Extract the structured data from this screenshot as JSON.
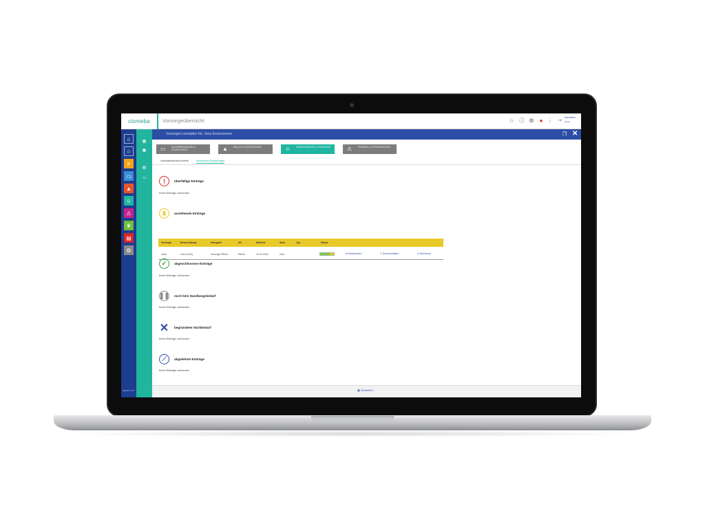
{
  "app": {
    "logo": "clomeba",
    "page_title": "Vorsorgeübersicht",
    "user": {
      "name": "Abmelden",
      "role": "admin"
    },
    "version": "Version 4.0.1"
  },
  "header": {
    "title": "Vorsorgen verwalten für: Jens Environment"
  },
  "categories": [
    {
      "label": "UNTERWEISUNGEN & SCHULUNGEN",
      "icon": "laptop-icon",
      "active": false
    },
    {
      "label": "SKILLS & KOMPETENZEN",
      "icon": "graduation-icon",
      "active": false
    },
    {
      "label": "ARBEITSMEDIZIN & VORSORGE",
      "icon": "doctor-icon",
      "active": true
    },
    {
      "label": "PRÄMIEN & GEFÄHRDUNGEN",
      "icon": "warning-icon",
      "active": false
    }
  ],
  "subtabs": [
    {
      "label": "Vorsorgeübersicht erstellt",
      "active": false
    },
    {
      "label": "Anstehende Bewertungen",
      "active": true
    }
  ],
  "sections": {
    "overdue": {
      "title": "überfällige Einträge",
      "empty": "Keine Einträge vorhanden.",
      "color": "#d9262a"
    },
    "upcoming": {
      "title": "anstehende Einträge",
      "color": "#e8c92a"
    },
    "completed": {
      "title": "abgeschlossene Einträge",
      "empty": "Keine Einträge vorhanden.",
      "color": "#2aa33a"
    },
    "no_action": {
      "title": "noch kein Handlungsbedarf",
      "empty": "Keine Einträge vorhanden.",
      "color": "#8a8a8a"
    },
    "not_required": {
      "title": "begründeter Nichtbedarf",
      "empty": "Keine Einträge vorhanden.",
      "color": "#2d4ea5"
    },
    "declined": {
      "title": "abgelehnte Einträge",
      "empty": "Keine Einträge vorhanden.",
      "color": "#2d4ea5"
    }
  },
  "table": {
    "headers": [
      "Vorsorge",
      "Beschreibung",
      "Kategorie",
      "AK",
      "Nächste",
      "Abst",
      "Typ",
      "Status"
    ],
    "row": {
      "vorsorge": "Lärm",
      "beschreibung": "Lärm (G20)",
      "kategorie": "Vorsorge Pflicht",
      "ak": "Pflicht",
      "naechste": "12.02.2020",
      "abst": "Uwe",
      "typ": "-",
      "status_progress": 0.7,
      "actions": [
        "Maßnahmen",
        "Dokumentation",
        "Stornieren"
      ]
    }
  },
  "footer": {
    "close_label": "Schließen"
  }
}
